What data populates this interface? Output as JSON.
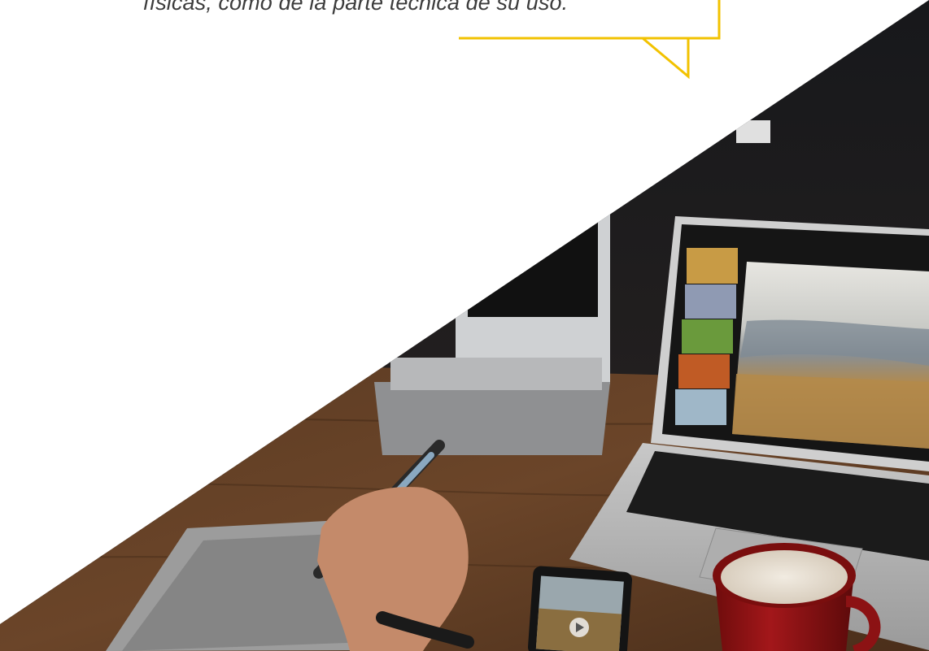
{
  "quote": {
    "text": "físicas, como de la parte técnica de su uso."
  },
  "colors": {
    "accent": "#F2C200",
    "text": "#3C3C3C",
    "background": "#FFFFFF"
  },
  "photo": {
    "icons": [
      "laptop-icon",
      "smartphone-icon",
      "stylus-icon",
      "mug-icon"
    ]
  }
}
